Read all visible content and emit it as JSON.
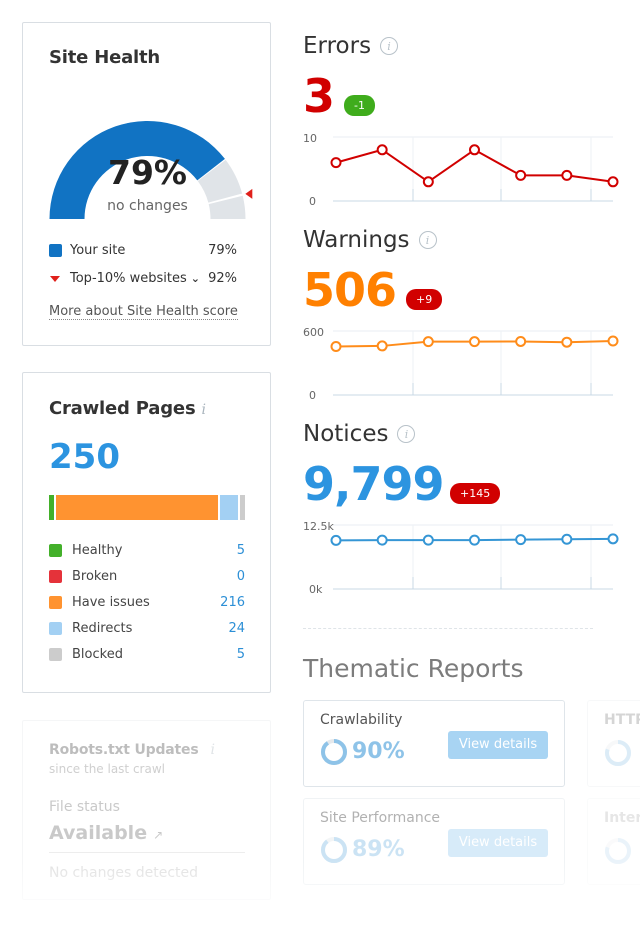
{
  "site_health": {
    "title": "Site Health",
    "score_label": "79%",
    "score": 79,
    "top10_score": 92,
    "change_label": "no changes",
    "legend": [
      {
        "label": "Your site",
        "value": "79%",
        "color": "#1173c3",
        "marker": "square"
      },
      {
        "label": "Top-10% websites",
        "value": "92%",
        "color": "#e0201b",
        "marker": "triangle",
        "dropdown": true
      }
    ],
    "more_link": "More about Site Health score",
    "colors": {
      "filled": "#1173c3",
      "empty": "#e0e4e8",
      "marker": "#e0201b"
    }
  },
  "crawled_pages": {
    "title": "Crawled Pages",
    "info_icon": "i",
    "total": "250",
    "segments": [
      {
        "label": "Healthy",
        "value": 5,
        "display": "5",
        "color": "#43b02a"
      },
      {
        "label": "Broken",
        "value": 0,
        "display": "0",
        "color": "#e5323a"
      },
      {
        "label": "Have issues",
        "value": 216,
        "display": "216",
        "color": "#ff9330"
      },
      {
        "label": "Redirects",
        "value": 24,
        "display": "24",
        "color": "#a3d0f3"
      },
      {
        "label": "Blocked",
        "value": 5,
        "display": "5",
        "color": "#cccccc"
      }
    ]
  },
  "robots": {
    "title": "Robots.txt Updates",
    "info_icon": "i",
    "subtitle": "since the last crawl",
    "file_status_label": "File status",
    "file_status_value": "Available",
    "external_icon": "↗",
    "note": "No changes detected"
  },
  "metrics": {
    "errors": {
      "title": "Errors",
      "value": "3",
      "delta": "-1",
      "value_color": "#d10000",
      "delta_color": "#3fac1c",
      "line_color": "#d10000",
      "chart": {
        "type": "line",
        "ylim": [
          0,
          10
        ],
        "y_ticks": [
          "10",
          "0"
        ],
        "values": [
          6,
          8,
          3,
          8,
          4,
          4,
          3
        ]
      }
    },
    "warnings": {
      "title": "Warnings",
      "value": "506",
      "delta": "+9",
      "value_color": "#ff8000",
      "delta_color": "#d10000",
      "line_color": "#ff8c1a",
      "chart": {
        "type": "line",
        "ylim": [
          0,
          600
        ],
        "y_ticks": [
          "600",
          "0"
        ],
        "values": [
          455,
          460,
          500,
          500,
          502,
          495,
          506
        ]
      }
    },
    "notices": {
      "title": "Notices",
      "value": "9,799",
      "delta": "+145",
      "value_color": "#2c94e0",
      "delta_color": "#d10000",
      "line_color": "#3596d5",
      "chart": {
        "type": "line",
        "ylim": [
          0,
          12500
        ],
        "y_ticks": [
          "12.5k",
          "0k"
        ],
        "values": [
          9500,
          9550,
          9550,
          9540,
          9650,
          9720,
          9799
        ]
      }
    }
  },
  "thematic": {
    "title": "Thematic Reports",
    "reports": [
      {
        "name": "Crawlability",
        "percent": "90%",
        "value": 90,
        "button": "View details"
      },
      {
        "name": "Site Performance",
        "percent": "89%",
        "value": 89,
        "button": "View details"
      },
      {
        "name": "HTTPS",
        "value": 80
      },
      {
        "name": "Internal Linking",
        "value": 80
      }
    ]
  }
}
